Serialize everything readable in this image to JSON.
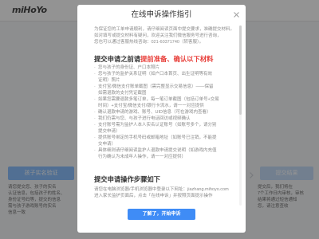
{
  "page": {
    "logo": "miHoYo",
    "steps": [
      {
        "label": "孩子实名验证",
        "desc": [
          "请您提交您、孩子的实名",
          "认证信息，包括孩子的姓名、",
          "身份证号码等，提交的信息",
          "需与孩子游戏账号的实名",
          "信息一致"
        ]
      },
      {
        "label": "提交结果",
        "desc": [
          "提交后，我们将在",
          "7个工作日内审核，审核",
          "结果将通过短信通知",
          "您，请注意查收"
        ]
      }
    ],
    "step_arrow_icon": "chevron-right-icon"
  },
  "modal": {
    "title": "在线申诉操作指引",
    "close_icon": "close-icon",
    "intro": [
      "为保证您的工单申请顺利，请仔细阅读页面中提交要求，准确提交材料。",
      "如对填写或提交材料有疑问，欢迎关注我们微信服务号进行咨询，",
      "您也可以通过客服热线咨询：021-60371740（转客服）。"
    ],
    "checklist": {
      "heading_plain": "提交申请之前请",
      "heading_highlight": "提前准备、确认以下材料",
      "items": [
        {
          "lines": [
            "您与孩子的身份证、户口本照片"
          ]
        },
        {
          "lines": [
            "您与孩子的监护关系证明（如户口本首页、出生证明等有效",
            "证明）照片"
          ]
        },
        {
          "lines": [
            "支付宝/微信支付账单截图（需完整显示交易信息）——保留",
            "如需退款的支付凭证截图"
          ]
        },
        {
          "lines": [
            "如果您需要退款多笔订单，每一笔订单截图（包括订单号+交易",
            "时间）+支付宝/微信支付/银行卡流水，请一一对应提供"
          ]
        },
        {
          "lines": [
            "确认退款申请的游戏、账号、UID信息（可在游戏内查看）"
          ]
        },
        {
          "lines": [
            "我们仍需与您、与孩子进行电话回访或视频确认"
          ]
        },
        {
          "lines": [
            "支付账号需为监护人本人实名认证账号（如账号多个，请分别",
            "提交申请）"
          ]
        },
        {
          "lines": [
            "提供账号绑定的手机号码或邮箱地址（如账号已注销，不能提",
            "交申请）"
          ]
        },
        {
          "lines": [
            "具体细则请仔细阅读监护人退款申请提交说明（如游戏内充值",
            "行为确认为未成年人操作，请一一对应提供）"
          ]
        }
      ]
    },
    "steps_section": {
      "heading": "提交申请操作步骤如下",
      "lines": [
        "请您在电脑浏览器/手机浏览器中登录以下网址：jiazhang.mihoyo.com",
        "进入家长监护页面后，点击「在线申诉」并按照页面提示操作"
      ]
    },
    "confirm_button": "了解了，开始申诉"
  },
  "colors": {
    "accent": "#3f8cf6",
    "highlight": "#e8413c",
    "step_active": "#7ab6ff",
    "step_inactive": "#bcd6f7"
  }
}
